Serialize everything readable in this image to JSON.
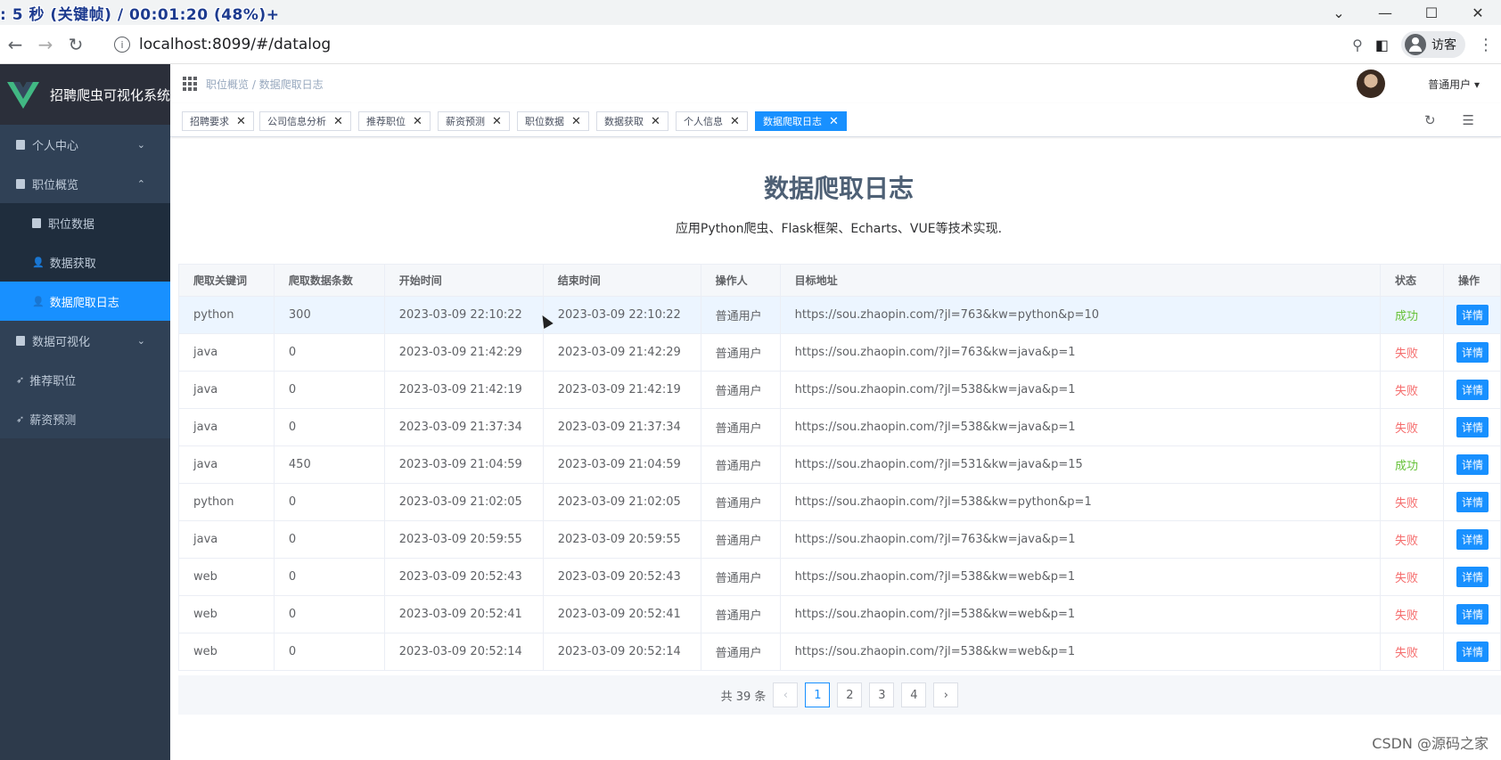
{
  "overlay": {
    "text": ": 5 秒 (关键帧) / 00:01:20 (48%)",
    "plus": "+"
  },
  "browser": {
    "url": "localhost:8099/#/datalog",
    "guest_label": "访客"
  },
  "sidebar": {
    "app_title": "招聘爬虫可视化系统",
    "items": [
      {
        "label": "个人中心"
      },
      {
        "label": "职位概览"
      },
      {
        "label": "职位数据"
      },
      {
        "label": "数据获取"
      },
      {
        "label": "数据爬取日志"
      },
      {
        "label": "数据可视化"
      },
      {
        "label": "推荐职位"
      },
      {
        "label": "薪资预测"
      }
    ]
  },
  "header": {
    "breadcrumb": "职位概览 / 数据爬取日志",
    "user": "普通用户"
  },
  "tags": [
    "招聘要求",
    "公司信息分析",
    "推荐职位",
    "薪资预测",
    "职位数据",
    "数据获取",
    "个人信息",
    "数据爬取日志"
  ],
  "main": {
    "title": "数据爬取日志",
    "subtitle": "应用Python爬虫、Flask框架、Echarts、VUE等技术实现."
  },
  "table": {
    "headers": [
      "爬取关键词",
      "爬取数据条数",
      "开始时间",
      "结束时间",
      "操作人",
      "目标地址",
      "状态",
      "操作"
    ],
    "action_label": "详情",
    "rows": [
      {
        "kw": "python",
        "count": "300",
        "start": "2023-03-09 22:10:22",
        "end": "2023-03-09 22:10:22",
        "op": "普通用户",
        "url": "https://sou.zhaopin.com/?jl=763&kw=python&p=10",
        "status": "成功"
      },
      {
        "kw": "java",
        "count": "0",
        "start": "2023-03-09 21:42:29",
        "end": "2023-03-09 21:42:29",
        "op": "普通用户",
        "url": "https://sou.zhaopin.com/?jl=763&kw=java&p=1",
        "status": "失败"
      },
      {
        "kw": "java",
        "count": "0",
        "start": "2023-03-09 21:42:19",
        "end": "2023-03-09 21:42:19",
        "op": "普通用户",
        "url": "https://sou.zhaopin.com/?jl=538&kw=java&p=1",
        "status": "失败"
      },
      {
        "kw": "java",
        "count": "0",
        "start": "2023-03-09 21:37:34",
        "end": "2023-03-09 21:37:34",
        "op": "普通用户",
        "url": "https://sou.zhaopin.com/?jl=538&kw=java&p=1",
        "status": "失败"
      },
      {
        "kw": "java",
        "count": "450",
        "start": "2023-03-09 21:04:59",
        "end": "2023-03-09 21:04:59",
        "op": "普通用户",
        "url": "https://sou.zhaopin.com/?jl=531&kw=java&p=15",
        "status": "成功"
      },
      {
        "kw": "python",
        "count": "0",
        "start": "2023-03-09 21:02:05",
        "end": "2023-03-09 21:02:05",
        "op": "普通用户",
        "url": "https://sou.zhaopin.com/?jl=538&kw=python&p=1",
        "status": "失败"
      },
      {
        "kw": "java",
        "count": "0",
        "start": "2023-03-09 20:59:55",
        "end": "2023-03-09 20:59:55",
        "op": "普通用户",
        "url": "https://sou.zhaopin.com/?jl=763&kw=java&p=1",
        "status": "失败"
      },
      {
        "kw": "web",
        "count": "0",
        "start": "2023-03-09 20:52:43",
        "end": "2023-03-09 20:52:43",
        "op": "普通用户",
        "url": "https://sou.zhaopin.com/?jl=538&kw=web&p=1",
        "status": "失败"
      },
      {
        "kw": "web",
        "count": "0",
        "start": "2023-03-09 20:52:41",
        "end": "2023-03-09 20:52:41",
        "op": "普通用户",
        "url": "https://sou.zhaopin.com/?jl=538&kw=web&p=1",
        "status": "失败"
      },
      {
        "kw": "web",
        "count": "0",
        "start": "2023-03-09 20:52:14",
        "end": "2023-03-09 20:52:14",
        "op": "普通用户",
        "url": "https://sou.zhaopin.com/?jl=538&kw=web&p=1",
        "status": "失败"
      }
    ]
  },
  "pagination": {
    "total": "共 39 条",
    "pages": [
      "1",
      "2",
      "3",
      "4"
    ],
    "prev": "‹",
    "next": "›"
  },
  "watermark": "CSDN @源码之家",
  "colors": {
    "accent": "#1890ff",
    "success": "#67c23a",
    "fail": "#f56c6c",
    "sidebar": "#304156"
  }
}
